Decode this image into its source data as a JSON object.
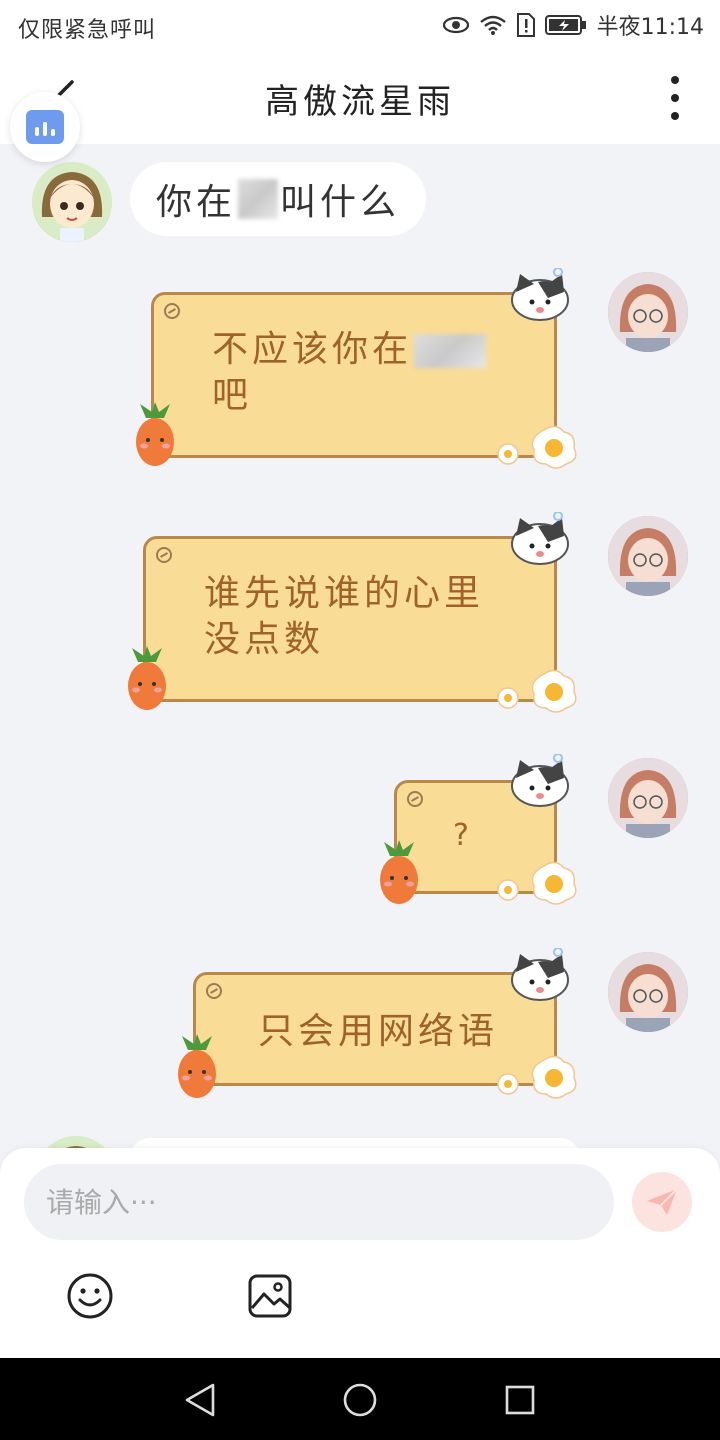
{
  "status_bar": {
    "left_text": "仅限紧急呼叫",
    "time": "半夜11:14",
    "icons": [
      "eye-icon",
      "wifi-icon",
      "sim-alert-icon",
      "battery-charging-icon"
    ]
  },
  "header": {
    "title": "高傲流星雨",
    "back_icon": "chevron-left-icon",
    "more_icon": "more-vertical-icon",
    "float_icon": "bar-chart-icon"
  },
  "messages": [
    {
      "from": "other",
      "text_before": "你在",
      "text_after": "叫什么",
      "censored": true
    },
    {
      "from": "me",
      "line1": "不应该你在",
      "line2": "吧",
      "censored": true
    },
    {
      "from": "me",
      "line1": "谁先说谁的心里",
      "line2": "没点数"
    },
    {
      "from": "me",
      "line1": "?"
    },
    {
      "from": "me",
      "line1": "只会用网络语"
    }
  ],
  "input": {
    "placeholder": "请输入···",
    "send_icon": "paper-plane-icon",
    "tools": [
      "smiley-icon",
      "image-icon"
    ]
  },
  "nav": {
    "icons": [
      "back-triangle-icon",
      "home-circle-icon",
      "recents-square-icon"
    ]
  },
  "colors": {
    "note_bg": "#f9dd96",
    "note_border": "#b8894b",
    "note_text": "#a0622b",
    "chat_bg": "#f2f3f7",
    "send_bg": "#fde3e0",
    "float_accent": "#6f9bef"
  }
}
